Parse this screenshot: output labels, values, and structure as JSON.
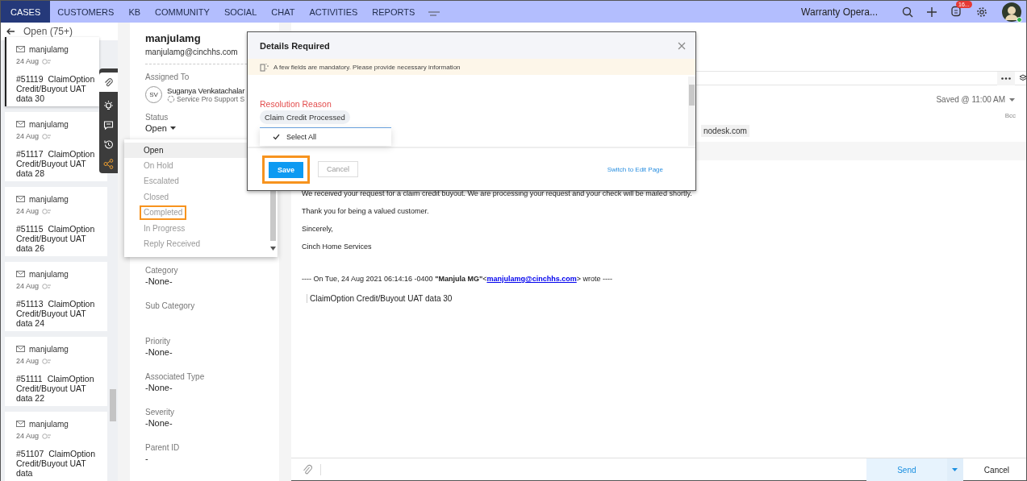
{
  "nav": {
    "tabs": [
      {
        "label": "CASES",
        "selected": true
      },
      {
        "label": "CUSTOMERS",
        "selected": false
      },
      {
        "label": "KB",
        "selected": false
      },
      {
        "label": "COMMUNITY",
        "selected": false
      },
      {
        "label": "SOCIAL",
        "selected": false
      },
      {
        "label": "CHAT",
        "selected": false
      },
      {
        "label": "ACTIVITIES",
        "selected": false
      },
      {
        "label": "REPORTS",
        "selected": false
      }
    ],
    "department": "Warranty Opera...",
    "notification_badge": "16..."
  },
  "case_list": {
    "view": "Open (75+)",
    "cards": [
      {
        "contact": "manjulamg",
        "date": "24 Aug",
        "number": "#51119",
        "subject": "ClaimOption Credit/Buyout UAT data 30",
        "selected": true
      },
      {
        "contact": "manjulamg",
        "date": "24 Aug",
        "number": "#51117",
        "subject": "ClaimOption Credit/Buyout UAT data 28",
        "selected": false
      },
      {
        "contact": "manjulamg",
        "date": "24 Aug",
        "number": "#51115",
        "subject": "ClaimOption Credit/Buyout UAT data 26",
        "selected": false
      },
      {
        "contact": "manjulamg",
        "date": "24 Aug",
        "number": "#51113",
        "subject": "ClaimOption Credit/Buyout UAT data 24",
        "selected": false
      },
      {
        "contact": "manjulamg",
        "date": "24 Aug",
        "number": "#51111",
        "subject": "ClaimOption Credit/Buyout UAT data 22",
        "selected": false
      },
      {
        "contact": "manjulamg",
        "date": "24 Aug",
        "number": "#51107",
        "subject": "ClaimOption Credit/Buyout UAT data",
        "selected": false
      }
    ]
  },
  "details": {
    "name": "manjulamg",
    "email": "manjulamg@cinchhs.com",
    "assigned_label": "Assigned To",
    "assignee_initials": "SV",
    "assignee": "Suganya Venkatachalar",
    "team": "Service Pro Support S",
    "status_label": "Status",
    "status": "Open",
    "fields": [
      {
        "label": "Category",
        "value": "-None-"
      },
      {
        "label": "Sub Category"
      },
      {
        "label": "Priority",
        "value": "-None-"
      },
      {
        "label": "Associated Type",
        "value": "-None-"
      },
      {
        "label": "Severity",
        "value": "-None-"
      },
      {
        "label": "Parent ID",
        "value": "-"
      }
    ]
  },
  "status_menu": {
    "options": [
      {
        "label": "Open",
        "selected": true,
        "highlighted": false
      },
      {
        "label": "On Hold",
        "selected": false,
        "highlighted": false
      },
      {
        "label": "Escalated",
        "selected": false,
        "highlighted": false
      },
      {
        "label": "Closed",
        "selected": false,
        "highlighted": false
      },
      {
        "label": "Completed",
        "selected": false,
        "highlighted": true
      },
      {
        "label": "In Progress",
        "selected": false,
        "highlighted": false
      },
      {
        "label": "Reply Received",
        "selected": false,
        "highlighted": false
      }
    ]
  },
  "modal": {
    "title": "Details Required",
    "notice": "A few fields are mandatory. Please provide necessary information",
    "field_label": "Resolution Reason",
    "field_value": "Claim Credit Processed",
    "option": {
      "label": "Select All",
      "checked": true
    },
    "save": {
      "label": "Save",
      "highlighted": true
    },
    "cancel": "Cancel",
    "switch_link": "Switch to Edit Page"
  },
  "reply": {
    "saved": "Saved @ 11:00 AM",
    "bcc": "Bcc",
    "recipient": "nodesk.com",
    "body": [
      "We received your request for a claim credit buyout.  We are processing your request and your check will be mailed shortly.",
      "Thank you for being a valued customer.",
      "Sincerely,",
      "Cinch Home Services"
    ],
    "quote_header": "---- On  Tue, 24 Aug 2021 06:14:16 -0400 **\"Manjula MG\"**<",
    "quote_link": "manjulamg@cinchhs.com",
    "quote_tail": ">  wrote ----",
    "quote": "ClaimOption Credit/Buyout UAT data 30",
    "send": "Send",
    "cancel": "Cancel"
  }
}
